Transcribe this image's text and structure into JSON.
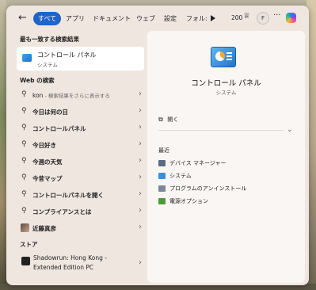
{
  "topbar": {
    "tabs": [
      "すべて",
      "アプリ",
      "ドキュメント",
      "ウェブ",
      "設定",
      "フォル:"
    ],
    "active_tab": 0,
    "count": "200",
    "avatar_initial": "F"
  },
  "left": {
    "best_match_heading": "最も一致する検索結果",
    "best_match": {
      "title": "コントロール パネル",
      "subtitle": "システム"
    },
    "web_heading": "Web の検索",
    "web_first": {
      "query": "kon",
      "hint": " - 検索結果をさらに表示する"
    },
    "web_results": [
      "今日は何の日",
      "コントロールパネル",
      "今日好き",
      "今週の天気",
      "今昔マップ",
      "コントロールパネルを開く",
      "コンプライアンスとは",
      "近藤真彦"
    ],
    "store_heading": "ストア",
    "store_item": {
      "line1": "Shadowrun: Hong Kong -",
      "line2": "Extended Edition PC"
    }
  },
  "right": {
    "title": "コントロール パネル",
    "subtitle": "システム",
    "open_label": "開く",
    "recent_heading": "最近",
    "recent_items": [
      "デバイス マネージャー",
      "システム",
      "プログラムのアンインストール",
      "電源オプション"
    ]
  },
  "icons": {
    "back": "back-arrow-icon",
    "search": "search-icon",
    "chevron": "chevron-right-icon",
    "play": "play-icon",
    "trophy": "trophy-icon",
    "more": "more-icon",
    "copilot": "copilot-icon",
    "open": "open-external-icon",
    "expand": "chevron-down-icon"
  },
  "colors": {
    "accent": "#1f64c8"
  }
}
